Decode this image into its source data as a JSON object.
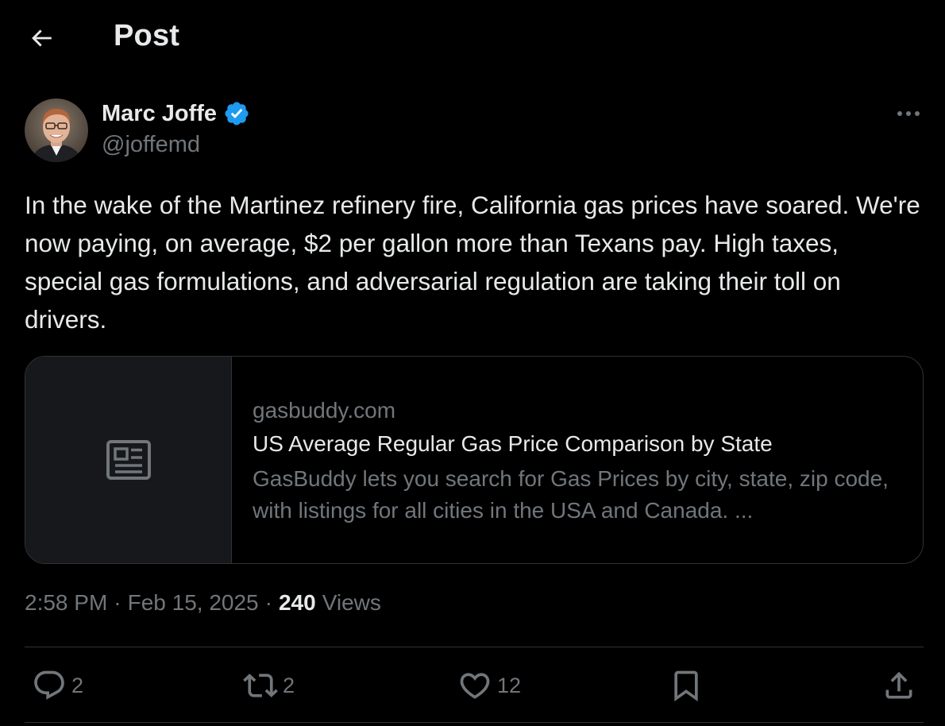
{
  "header": {
    "title": "Post"
  },
  "author": {
    "name": "Marc Joffe",
    "handle": "@joffemd"
  },
  "tweet": {
    "text": "In the wake of the Martinez refinery fire, California gas prices have soared. We're now paying, on average, $2 per gallon more than Texans pay. High taxes, special gas formulations, and adversarial regulation are taking their toll on drivers."
  },
  "link_card": {
    "domain": "gasbuddy.com",
    "title": "US Average Regular Gas Price Comparison by State",
    "description": "GasBuddy lets you search for Gas Prices by city, state, zip code, with listings for all cities in the USA and Canada. ..."
  },
  "meta": {
    "time": "2:58 PM",
    "date": "Feb 15, 2025",
    "separator": "·",
    "views_count": "240",
    "views_label": "Views"
  },
  "actions": {
    "replies": "2",
    "reposts": "2",
    "likes": "12"
  },
  "colors": {
    "background": "#000000",
    "text_primary": "#e7e9ea",
    "text_secondary": "#71767b",
    "border": "#2f3336",
    "verified_blue": "#1d9bf0"
  },
  "icons": [
    "back-arrow-icon",
    "verified-badge-icon",
    "more-icon",
    "article-icon",
    "reply-icon",
    "repost-icon",
    "like-icon",
    "bookmark-icon",
    "share-icon"
  ]
}
